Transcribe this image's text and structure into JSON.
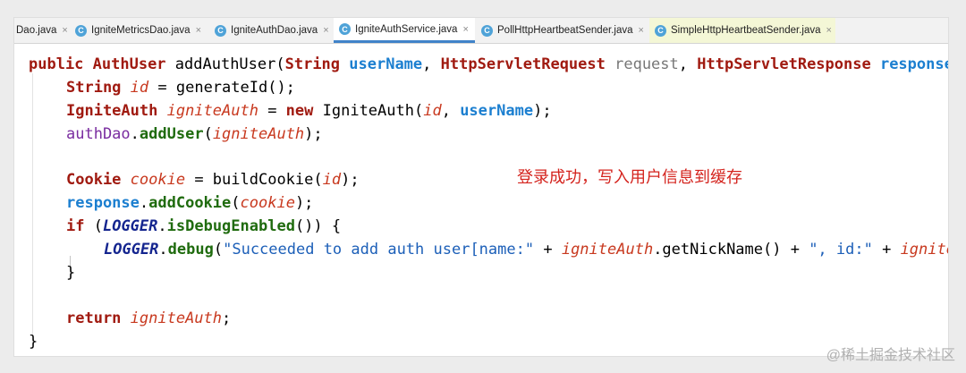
{
  "tabs": [
    {
      "label": "Dao.java",
      "icon": "none",
      "active": false
    },
    {
      "label": "IgniteMetricsDao.java",
      "icon": "class-c-icon",
      "active": false
    },
    {
      "label": "IgniteAuthDao.java",
      "icon": "class-c-icon",
      "active": false
    },
    {
      "label": "IgniteAuthService.java",
      "icon": "class-c-icon",
      "active": true
    },
    {
      "label": "PollHttpHeartbeatSender.java",
      "icon": "class-c-icon",
      "active": false
    },
    {
      "label": "SimpleHttpHeartbeatSender.java",
      "icon": "class-c-icon",
      "active": false
    }
  ],
  "tab_close_symbol": "×",
  "tab_icon_letter": "C",
  "code": {
    "l1": {
      "kw1": "public ",
      "t1": "AuthUser ",
      "m": "addAuthUser(",
      "t2": "String ",
      "p1": "userName",
      ",1": ", ",
      "t3": "HttpServletRequest ",
      "p2": "request",
      ",2": ", ",
      "t4": "HttpServletResponse ",
      "p3": "response) {"
    },
    "l2": {
      "t": "String ",
      "v": "id",
      " =": " = ",
      "m": "generateId();"
    },
    "l3": {
      "t": "IgniteAuth ",
      "v": "igniteAuth",
      " =": " = ",
      "kw": "new ",
      "c": "IgniteAuth(",
      "a1": "id",
      ",": ", ",
      "a2": "userName",
      ")": ");"
    },
    "l4": {
      "f": "authDao",
      ".": ".",
      "m": "addUser",
      "(": "(",
      "a": "igniteAuth",
      ")": ");"
    },
    "l6": {
      "t": "Cookie ",
      "v": "cookie",
      " =": " = ",
      "m": "buildCookie(",
      "a": "id",
      ")": ");"
    },
    "l7": {
      "f": "response",
      ".": ".",
      "m": "addCookie",
      "(": "(",
      "a": "cookie",
      ")": ");"
    },
    "l8": {
      "kw": "if ",
      "o": "(",
      "c": "LOGGER",
      ".": ".",
      "m": "isDebugEnabled",
      "r": "()) {"
    },
    "l9": {
      "c": "LOGGER",
      ".": ".",
      "m": "debug",
      "(": "(",
      "s1": "\"Succeeded to add auth user[name:\"",
      " +": " + ",
      "v": "igniteAuth",
      "g": ".getNickName() + ",
      "s2": "\", id:\"",
      " +2": " + ",
      "v2": "igniteAuth.getId()"
    },
    "l10": {
      "b": "}"
    },
    "l12": {
      "kw": "return ",
      "v": "igniteAuth",
      ";": ";"
    },
    "l13": {
      "b": "}"
    }
  },
  "annotation": "登录成功，写入用户信息到缓存",
  "watermark": "@稀土掘金技术社区"
}
